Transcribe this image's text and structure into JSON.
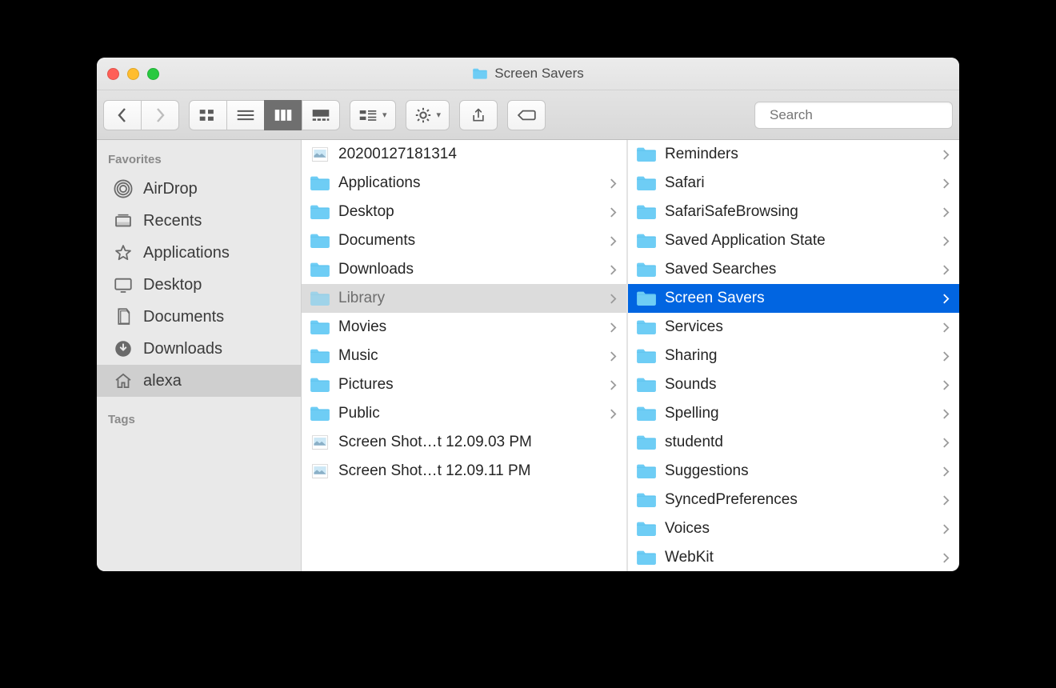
{
  "window": {
    "title": "Screen Savers"
  },
  "search": {
    "placeholder": "Search",
    "value": ""
  },
  "sidebar": {
    "headings": {
      "favorites": "Favorites",
      "tags": "Tags"
    },
    "favorites": [
      {
        "label": "AirDrop",
        "icon": "airdrop",
        "selected": false
      },
      {
        "label": "Recents",
        "icon": "recents",
        "selected": false
      },
      {
        "label": "Applications",
        "icon": "applications",
        "selected": false
      },
      {
        "label": "Desktop",
        "icon": "desktop",
        "selected": false
      },
      {
        "label": "Documents",
        "icon": "documents",
        "selected": false
      },
      {
        "label": "Downloads",
        "icon": "downloads",
        "selected": false
      },
      {
        "label": "alexa",
        "icon": "home",
        "selected": true
      }
    ]
  },
  "columns": [
    {
      "items": [
        {
          "label": "20200127181314",
          "type": "image",
          "folder": false,
          "state": ""
        },
        {
          "label": "Applications",
          "type": "folder",
          "folder": true,
          "state": ""
        },
        {
          "label": "Desktop",
          "type": "folder",
          "folder": true,
          "state": ""
        },
        {
          "label": "Documents",
          "type": "folder",
          "folder": true,
          "state": ""
        },
        {
          "label": "Downloads",
          "type": "folder",
          "folder": true,
          "state": ""
        },
        {
          "label": "Library",
          "type": "folder",
          "folder": true,
          "state": "open"
        },
        {
          "label": "Movies",
          "type": "folder",
          "folder": true,
          "state": ""
        },
        {
          "label": "Music",
          "type": "folder",
          "folder": true,
          "state": ""
        },
        {
          "label": "Pictures",
          "type": "folder",
          "folder": true,
          "state": ""
        },
        {
          "label": "Public",
          "type": "folder",
          "folder": true,
          "state": ""
        },
        {
          "label": "Screen Shot…t 12.09.03 PM",
          "type": "image",
          "folder": false,
          "state": ""
        },
        {
          "label": "Screen Shot…t 12.09.11 PM",
          "type": "image",
          "folder": false,
          "state": ""
        }
      ]
    },
    {
      "items": [
        {
          "label": "Reminders",
          "type": "folder",
          "folder": true,
          "state": ""
        },
        {
          "label": "Safari",
          "type": "folder",
          "folder": true,
          "state": ""
        },
        {
          "label": "SafariSafeBrowsing",
          "type": "folder",
          "folder": true,
          "state": ""
        },
        {
          "label": "Saved Application State",
          "type": "folder",
          "folder": true,
          "state": ""
        },
        {
          "label": "Saved Searches",
          "type": "folder",
          "folder": true,
          "state": ""
        },
        {
          "label": "Screen Savers",
          "type": "folder",
          "folder": true,
          "state": "selected"
        },
        {
          "label": "Services",
          "type": "folder",
          "folder": true,
          "state": ""
        },
        {
          "label": "Sharing",
          "type": "folder",
          "folder": true,
          "state": ""
        },
        {
          "label": "Sounds",
          "type": "folder",
          "folder": true,
          "state": ""
        },
        {
          "label": "Spelling",
          "type": "folder",
          "folder": true,
          "state": ""
        },
        {
          "label": "studentd",
          "type": "folder",
          "folder": true,
          "state": ""
        },
        {
          "label": "Suggestions",
          "type": "folder",
          "folder": true,
          "state": ""
        },
        {
          "label": "SyncedPreferences",
          "type": "folder",
          "folder": true,
          "state": ""
        },
        {
          "label": "Voices",
          "type": "folder",
          "folder": true,
          "state": ""
        },
        {
          "label": "WebKit",
          "type": "folder",
          "folder": true,
          "state": ""
        }
      ]
    }
  ]
}
